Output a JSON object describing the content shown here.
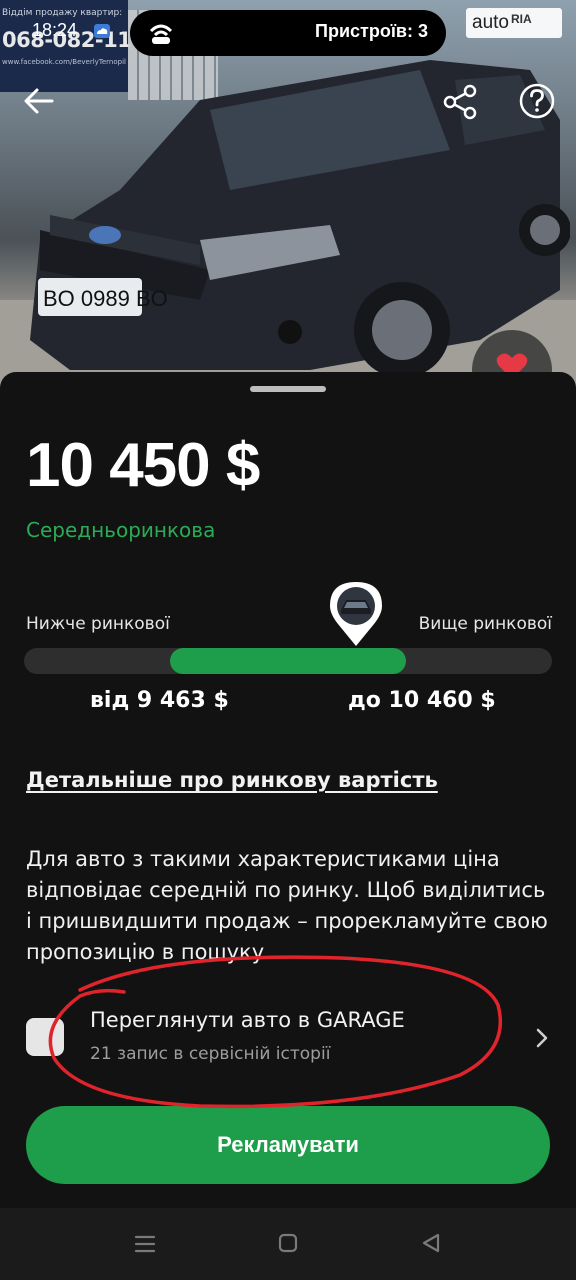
{
  "status_bar": {
    "time": "18:24",
    "devices_label": "Пристроїв: 3"
  },
  "photo": {
    "billboard_top": "Віддім продажу квартир:",
    "billboard_phone": "068-082-1111",
    "billboard_small": "www.facebook.com/BeverlyTernopil",
    "plate": "BO 0989 BO"
  },
  "watermark": {
    "auto": "auto",
    "ria": "RIA"
  },
  "price": "10 450 $",
  "market_status": "Середньоринкова",
  "range": {
    "below_label": "Нижче ринкової",
    "above_label": "Вище ринкової",
    "from": "від 9 463 $",
    "to": "до 10 460 $"
  },
  "details_link": "Детальніше про ринкову вартість",
  "description": "Для авто з такими характеристиками ціна відповідає середній по ринку. Щоб виділитись і пришвидшити продаж – прорекламуйте свою пропозицію в пошуку",
  "garage": {
    "title": "Переглянути авто в GARAGE",
    "subtitle": "21 запис в сервісній історії"
  },
  "promote_button": "Рекламувати",
  "colors": {
    "accent": "#1e9e4a",
    "market_text": "#2bab55",
    "sheet_bg": "#121212",
    "annotation": "#e0242b"
  }
}
